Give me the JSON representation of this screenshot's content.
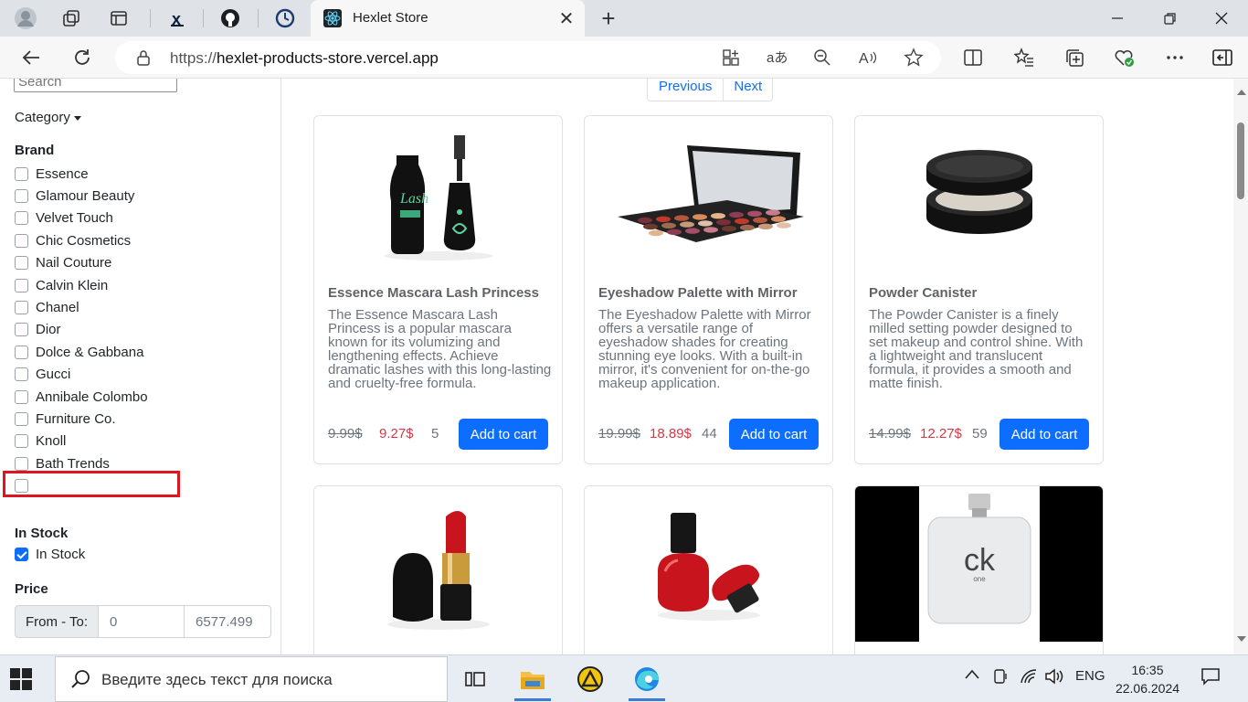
{
  "browser": {
    "active_tab_title": "Hexlet Store",
    "url_scheme": "https://",
    "url_host": "hexlet-products-store.vercel.app"
  },
  "sidebar": {
    "search_placeholder": "Search",
    "category_label": "Category",
    "brand_title": "Brand",
    "brands": [
      {
        "label": "Essence",
        "checked": false
      },
      {
        "label": "Glamour Beauty",
        "checked": false
      },
      {
        "label": "Velvet Touch",
        "checked": false
      },
      {
        "label": "Chic Cosmetics",
        "checked": false
      },
      {
        "label": "Nail Couture",
        "checked": false
      },
      {
        "label": "Calvin Klein",
        "checked": false
      },
      {
        "label": "Chanel",
        "checked": false
      },
      {
        "label": "Dior",
        "checked": false
      },
      {
        "label": "Dolce & Gabbana",
        "checked": false
      },
      {
        "label": "Gucci",
        "checked": false
      },
      {
        "label": "Annibale Colombo",
        "checked": false
      },
      {
        "label": "Furniture Co.",
        "checked": false
      },
      {
        "label": "Knoll",
        "checked": false
      },
      {
        "label": "Bath Trends",
        "checked": false
      },
      {
        "label": "",
        "checked": false
      }
    ],
    "in_stock_title": "In Stock",
    "in_stock_label": "In Stock",
    "in_stock_checked": true,
    "price_title": "Price",
    "price_from_to_label": "From - To:",
    "price_from": "0",
    "price_to": "6577.499"
  },
  "pagination": {
    "previous": "Previous",
    "next": "Next"
  },
  "products": [
    {
      "title": "Essence Mascara Lash Princess",
      "description": "The Essence Mascara Lash Princess is a popular mascara known for its volumizing and lengthening effects. Achieve dramatic lashes with this long-lasting and cruelty-free formula.",
      "old_price": "9.99$",
      "new_price": "9.27$",
      "stock": "5",
      "button": "Add to cart"
    },
    {
      "title": "Eyeshadow Palette with Mirror",
      "description": "The Eyeshadow Palette with Mirror offers a versatile range of eyeshadow shades for creating stunning eye looks. With a built-in mirror, it's convenient for on-the-go makeup application.",
      "old_price": "19.99$",
      "new_price": "18.89$",
      "stock": "44",
      "button": "Add to cart"
    },
    {
      "title": "Powder Canister",
      "description": "The Powder Canister is a finely milled setting powder designed to set makeup and control shine. With a lightweight and translucent formula, it provides a smooth and matte finish.",
      "old_price": "14.99$",
      "new_price": "12.27$",
      "stock": "59",
      "button": "Add to cart"
    }
  ],
  "perfume_label": "ck",
  "perfume_sub": "one",
  "taskbar": {
    "search_placeholder": "Введите здесь текст для поиска",
    "language": "ENG",
    "time": "16:35",
    "date": "22.06.2024"
  },
  "colors": {
    "accent": "#0d6efd",
    "sale": "#dc3545",
    "highlight": "#e0161e"
  }
}
